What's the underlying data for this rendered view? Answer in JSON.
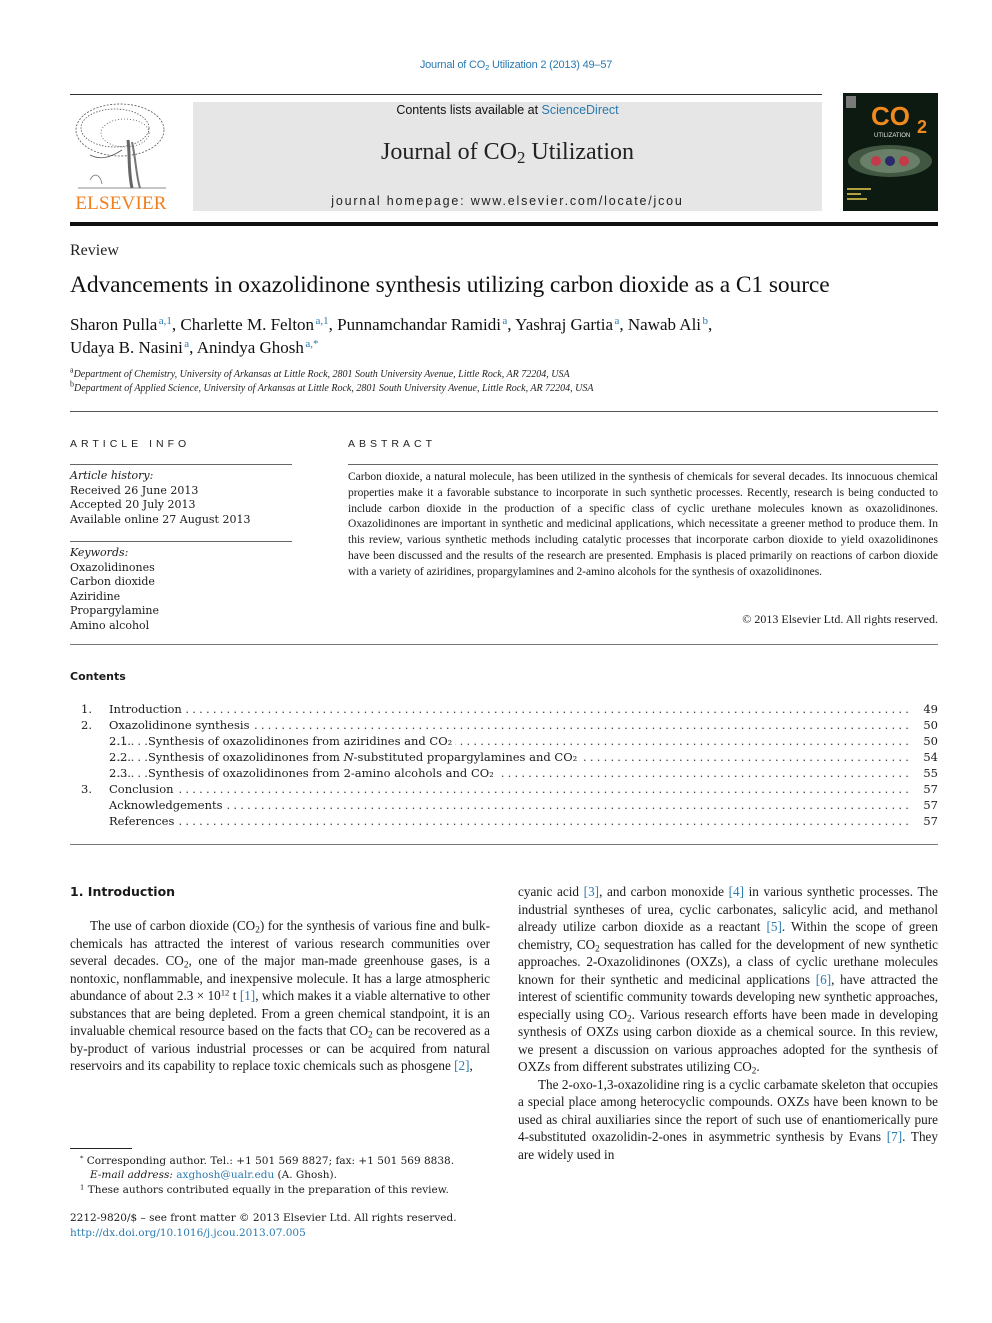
{
  "header": {
    "citation_prefix": "Journal of CO",
    "citation_sub": "2",
    "citation_suffix": " Utilization 2 (2013) 49–57",
    "contents_prefix": "Contents lists available at ",
    "contents_link": "ScienceDirect",
    "journal_title_prefix": "Journal of CO",
    "journal_title_sub": "2",
    "journal_title_suffix": " Utilization",
    "homepage_label": "journal homepage: ",
    "homepage_url": "www.elsevier.com/locate/jcou",
    "publisher_logo_text": "ELSEVIER",
    "publisher_logo_icon": "tree-icon",
    "cover": {
      "big_text": "CO",
      "big_sub": "2",
      "small_text": "UTILIZATION",
      "icon": "co2-molecule-icon"
    },
    "brand_color": "#f07e1a",
    "link_color": "#2a7ab0"
  },
  "article": {
    "type": "Review",
    "title": "Advancements in oxazolidinone synthesis utilizing carbon dioxide as a C1 source",
    "authors_line1": [
      {
        "name": "Sharon Pulla",
        "sup": "a,1",
        "sep": ", "
      },
      {
        "name": "Charlette M. Felton",
        "sup": "a,1",
        "sep": ", "
      },
      {
        "name": "Punnamchandar Ramidi",
        "sup": "a",
        "sep": ", "
      },
      {
        "name": "Yashraj Gartia",
        "sup": "a",
        "sep": ", "
      },
      {
        "name": "Nawab Ali",
        "sup": "b",
        "sep": ","
      }
    ],
    "authors_line2": [
      {
        "name": "Udaya B. Nasini",
        "sup": "a",
        "sep": ", "
      },
      {
        "name": "Anindya Ghosh",
        "sup": "a,*",
        "sep": ""
      }
    ],
    "affiliations": [
      {
        "key": "a",
        "text": "Department of Chemistry, University of Arkansas at Little Rock, 2801 South University Avenue, Little Rock, AR 72204, USA"
      },
      {
        "key": "b",
        "text": "Department of Applied Science, University of Arkansas at Little Rock, 2801 South University Avenue, Little Rock, AR 72204, USA"
      }
    ]
  },
  "article_info": {
    "heading": "ARTICLE INFO",
    "history_label": "Article history:",
    "history": [
      "Received 26 June 2013",
      "Accepted 20 July 2013",
      "Available online 27 August 2013"
    ],
    "keywords_label": "Keywords:",
    "keywords": [
      "Oxazolidinones",
      "Carbon dioxide",
      "Aziridine",
      "Propargylamine",
      "Amino alcohol"
    ]
  },
  "abstract": {
    "heading": "ABSTRACT",
    "text": "Carbon dioxide, a natural molecule, has been utilized in the synthesis of chemicals for several decades. Its innocuous chemical properties make it a favorable substance to incorporate in such synthetic processes. Recently, research is being conducted to include carbon dioxide in the production of a specific class of cyclic urethane molecules known as oxazolidinones. Oxazolidinones are important in synthetic and medicinal applications, which necessitate a greener method to produce them. In this review, various synthetic methods including catalytic processes that incorporate carbon dioxide to yield oxazolidinones have been discussed and the results of the research are presented. Emphasis is placed primarily on reactions of carbon dioxide with a variety of aziridines, propargylamines and 2-amino alcohols for the synthesis of oxazolidinones.",
    "copyright": "© 2013 Elsevier Ltd. All rights reserved."
  },
  "contents": {
    "heading": "Contents",
    "items": [
      {
        "num": "1.",
        "level": 1,
        "label": "Introduction",
        "page": "49"
      },
      {
        "num": "2.",
        "level": 1,
        "label": "Oxazolidinone synthesis",
        "page": "50"
      },
      {
        "num": "2.1.",
        "level": 2,
        "label": "Synthesis of oxazolidinones from aziridines and CO₂",
        "page": "50"
      },
      {
        "num": "2.2.",
        "level": 2,
        "label": "Synthesis of oxazolidinones from N-substituted propargylamines and CO₂",
        "page": "54"
      },
      {
        "num": "2.3.",
        "level": 2,
        "label": "Synthesis of oxazolidinones from 2-amino alcohols and CO₂",
        "page": "55"
      },
      {
        "num": "3.",
        "level": 1,
        "label": "Conclusion",
        "page": "57"
      },
      {
        "num": "",
        "level": 1,
        "label": "Acknowledgements",
        "page": "57"
      },
      {
        "num": "",
        "level": 1,
        "label": "References",
        "page": "57"
      }
    ]
  },
  "body": {
    "intro_heading": "1.  Introduction",
    "left_p1_a": "The use of carbon dioxide (CO",
    "left_p1_b": ") for the synthesis of various fine and bulk-chemicals has attracted the interest of various research communities over several decades. CO",
    "left_p1_c": ", one of the major man-made greenhouse gases, is a nontoxic, nonflammable, and inexpensive molecule. It has a large atmospheric abundance of about 2.3 × 10",
    "left_p1_exp": "12",
    "left_p1_d": " t ",
    "ref1": "[1]",
    "left_p1_e": ", which makes it a viable alternative to other substances that are being depleted. From a green chemical standpoint, it is an invaluable chemical resource based on the facts that CO",
    "left_p1_f": " can be recovered as a by-product of various industrial processes or can be acquired from natural reservoirs and its capability to replace toxic chemicals such as phosgene ",
    "ref2": "[2]",
    "left_p1_g": ",",
    "right_p1_a": "cyanic acid ",
    "ref3": "[3]",
    "right_p1_b": ", and carbon monoxide ",
    "ref4": "[4]",
    "right_p1_c": " in various synthetic processes. The industrial syntheses of urea, cyclic carbonates, salicylic acid, and methanol already utilize carbon dioxide as a reactant ",
    "ref5": "[5]",
    "right_p1_d": ". Within the scope of green chemistry, CO",
    "right_p1_e": " sequestration has called for the development of new synthetic approaches. 2-Oxazolidinones (OXZs), a class of cyclic urethane molecules known for their synthetic and medicinal applications ",
    "ref6": "[6]",
    "right_p1_f": ", have attracted the interest of scientific community towards developing new synthetic approaches, especially using CO",
    "right_p1_g": ". Various research efforts have been made in developing synthesis of OXZs using carbon dioxide as a chemical source. In this review, we present a discussion on various approaches adopted for the synthesis of OXZs from different substrates utilizing CO",
    "right_p1_h": ".",
    "right_p2_a": "The 2-oxo-1,3-oxazolidine ring is a cyclic carbamate skeleton that occupies a special place among heterocyclic compounds. OXZs have been known to be used as chiral auxiliaries since the report of such use of enantiomerically pure 4-substituted oxazolidin-2-ones in asymmetric synthesis by Evans ",
    "ref7": "[7]",
    "right_p2_b": ". They are widely used in",
    "sub2": "2"
  },
  "footnotes": {
    "star_mark": "*",
    "star_text": "Corresponding author. Tel.: +1 501 569 8827; fax: +1 501 569 8838.",
    "email_label": "E-mail address: ",
    "email": "axghosh@ualr.edu",
    "email_suffix": " (A. Ghosh).",
    "one_mark": "1",
    "one_text": "These authors contributed equally in the preparation of this review.",
    "front_matter": "2212-9820/$ – see front matter © 2013 Elsevier Ltd. All rights reserved.",
    "doi": "http://dx.doi.org/10.1016/j.jcou.2013.07.005"
  }
}
